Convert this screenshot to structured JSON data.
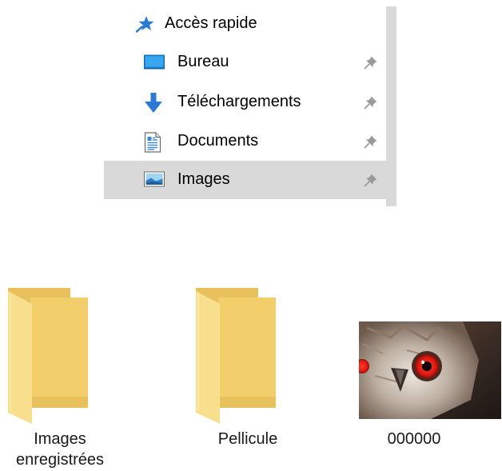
{
  "nav": {
    "quick_access": "Accès rapide",
    "items": [
      {
        "label": "Bureau",
        "icon": "desktop-icon",
        "pinned": true
      },
      {
        "label": "Téléchargements",
        "icon": "downloads-arrow-icon",
        "pinned": true
      },
      {
        "label": "Documents",
        "icon": "documents-icon",
        "pinned": true
      },
      {
        "label": "Images",
        "icon": "pictures-icon",
        "pinned": true,
        "selected": true
      }
    ]
  },
  "content": {
    "items": [
      {
        "name": "Images enregistrées",
        "type": "folder"
      },
      {
        "name": "Pellicule",
        "type": "folder"
      },
      {
        "name": "000000",
        "type": "image-file"
      }
    ]
  },
  "colors": {
    "selection": "#d9d9d9",
    "quick_access_star": "#2b79d0",
    "folder_front": "#f6d87f",
    "folder_back": "#e9c15c",
    "download_arrow": "#2b79d0"
  }
}
